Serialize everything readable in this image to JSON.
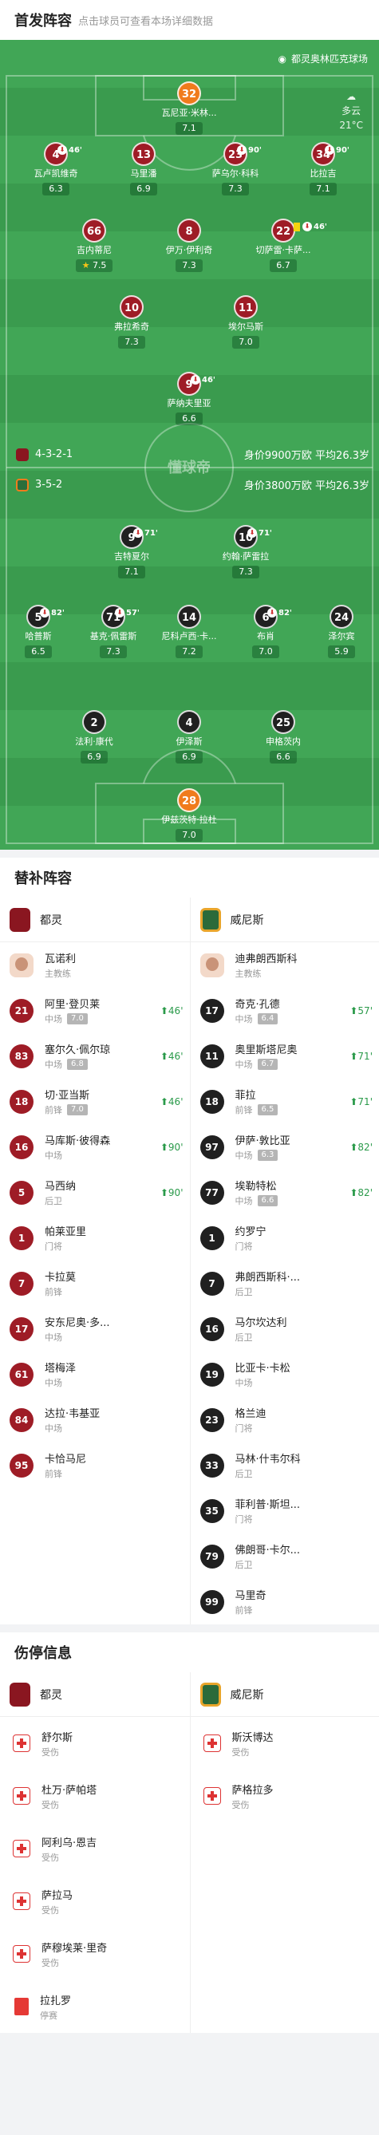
{
  "lineup": {
    "title": "首发阵容",
    "subtitle": "点击球员可查看本场详细数据",
    "venue": "都灵奥林匹克球场",
    "weather": {
      "condition": "多云",
      "temp": "21°C"
    },
    "home": {
      "formation": "4-3-2-1",
      "value": "身价9900万欧",
      "age": "平均26.3岁"
    },
    "away": {
      "formation": "3-5-2",
      "value": "身价3800万欧",
      "age": "平均26.3岁"
    },
    "watermark": "懂球帝",
    "players": [
      {
        "num": "32",
        "name": "瓦尼亚·米林...",
        "rating": "7.1"
      },
      {
        "num": "4",
        "name": "瓦卢凯维奇",
        "rating": "6.3",
        "sub": "46'"
      },
      {
        "num": "13",
        "name": "马里潘",
        "rating": "6.9"
      },
      {
        "num": "23",
        "name": "萨乌尔·科科",
        "rating": "7.3",
        "sub": "90'"
      },
      {
        "num": "34",
        "name": "比拉吉",
        "rating": "7.1",
        "sub": "90'"
      },
      {
        "num": "66",
        "name": "吉内蒂尼",
        "rating": "7.5"
      },
      {
        "num": "8",
        "name": "伊万·伊利奇",
        "rating": "7.3"
      },
      {
        "num": "22",
        "name": "切萨雷·卡萨...",
        "rating": "6.7",
        "sub": "46'"
      },
      {
        "num": "10",
        "name": "弗拉希奇",
        "rating": "7.3"
      },
      {
        "num": "11",
        "name": "埃尔马斯",
        "rating": "7.0"
      },
      {
        "num": "9",
        "name": "萨纳夫里亚",
        "rating": "6.6",
        "sub": "46'"
      },
      {
        "num": "9",
        "name": "吉特夏尔",
        "rating": "7.1",
        "sub": "71'"
      },
      {
        "num": "10",
        "name": "约翰·萨雷拉",
        "rating": "7.3",
        "sub": "71'"
      },
      {
        "num": "5",
        "name": "哈普斯",
        "rating": "6.5",
        "sub": "82'"
      },
      {
        "num": "71",
        "name": "基克·佩雷斯",
        "rating": "7.3",
        "sub": "57'"
      },
      {
        "num": "14",
        "name": "尼科卢西·卡...",
        "rating": "7.2"
      },
      {
        "num": "6",
        "name": "布肖",
        "rating": "7.0",
        "sub": "82'"
      },
      {
        "num": "24",
        "name": "泽尔宾",
        "rating": "5.9"
      },
      {
        "num": "2",
        "name": "法利·康代",
        "rating": "6.9"
      },
      {
        "num": "4",
        "name": "伊泽斯",
        "rating": "6.9"
      },
      {
        "num": "25",
        "name": "申格茨内",
        "rating": "6.6"
      },
      {
        "num": "28",
        "name": "伊兹茨特·拉杜",
        "rating": "7.0"
      }
    ]
  },
  "subs": {
    "title": "替补阵容",
    "home_team": "都灵",
    "away_team": "威尼斯",
    "home_coach": {
      "name": "瓦诺利",
      "role": "主教练"
    },
    "away_coach": {
      "name": "迪弗朗西斯科",
      "role": "主教练"
    },
    "home": [
      {
        "num": "21",
        "name": "阿里·登贝莱",
        "pos": "中场",
        "rating": "7.0",
        "in": "46'"
      },
      {
        "num": "83",
        "name": "塞尔久·佩尔琼",
        "pos": "中场",
        "rating": "6.8",
        "in": "46'"
      },
      {
        "num": "18",
        "name": "切·亚当斯",
        "pos": "前锋",
        "rating": "7.0",
        "in": "46'"
      },
      {
        "num": "16",
        "name": "马库斯·彼得森",
        "pos": "中场",
        "in": "90'"
      },
      {
        "num": "5",
        "name": "马西纳",
        "pos": "后卫",
        "in": "90'"
      },
      {
        "num": "1",
        "name": "帕莱亚里",
        "pos": "门将"
      },
      {
        "num": "7",
        "name": "卡拉莫",
        "pos": "前锋"
      },
      {
        "num": "17",
        "name": "安东尼奥·多...",
        "pos": "中场"
      },
      {
        "num": "61",
        "name": "塔梅泽",
        "pos": "中场"
      },
      {
        "num": "84",
        "name": "达拉·韦基亚",
        "pos": "中场"
      },
      {
        "num": "95",
        "name": "卡恰马尼",
        "pos": "前锋"
      }
    ],
    "away": [
      {
        "num": "17",
        "name": "奇克·孔德",
        "pos": "中场",
        "rating": "6.4",
        "in": "57'"
      },
      {
        "num": "11",
        "name": "奥里斯塔尼奥",
        "pos": "中场",
        "rating": "6.7",
        "in": "71'"
      },
      {
        "num": "18",
        "name": "菲拉",
        "pos": "前锋",
        "rating": "6.5",
        "in": "71'"
      },
      {
        "num": "97",
        "name": "伊萨·敦比亚",
        "pos": "中场",
        "rating": "6.3",
        "in": "82'"
      },
      {
        "num": "77",
        "name": "埃勒特松",
        "pos": "中场",
        "rating": "6.6",
        "in": "82'"
      },
      {
        "num": "1",
        "name": "约罗宁",
        "pos": "门将"
      },
      {
        "num": "7",
        "name": "弗朗西斯科·...",
        "pos": "后卫"
      },
      {
        "num": "16",
        "name": "马尔坎达利",
        "pos": "后卫"
      },
      {
        "num": "19",
        "name": "比亚卡·卡松",
        "pos": "中场"
      },
      {
        "num": "23",
        "name": "格兰迪",
        "pos": "门将"
      },
      {
        "num": "33",
        "name": "马林·什韦尔科",
        "pos": "后卫"
      },
      {
        "num": "35",
        "name": "菲利普·斯坦...",
        "pos": "门将"
      },
      {
        "num": "79",
        "name": "佛朗哥·卡尔...",
        "pos": "后卫"
      },
      {
        "num": "99",
        "name": "马里奇",
        "pos": "前锋"
      }
    ]
  },
  "injuries": {
    "title": "伤停信息",
    "home": [
      {
        "name": "舒尔斯",
        "status": "受伤",
        "type": "injury"
      },
      {
        "name": "杜万·萨帕塔",
        "status": "受伤",
        "type": "injury"
      },
      {
        "name": "阿利乌·恩吉",
        "status": "受伤",
        "type": "injury"
      },
      {
        "name": "萨拉马",
        "status": "受伤",
        "type": "injury"
      },
      {
        "name": "萨穆埃莱·里奇",
        "status": "受伤",
        "type": "injury"
      },
      {
        "name": "拉扎罗",
        "status": "停赛",
        "type": "suspension"
      }
    ],
    "away": [
      {
        "name": "斯沃博达",
        "status": "受伤",
        "type": "injury"
      },
      {
        "name": "萨格拉多",
        "status": "受伤",
        "type": "injury"
      }
    ]
  }
}
